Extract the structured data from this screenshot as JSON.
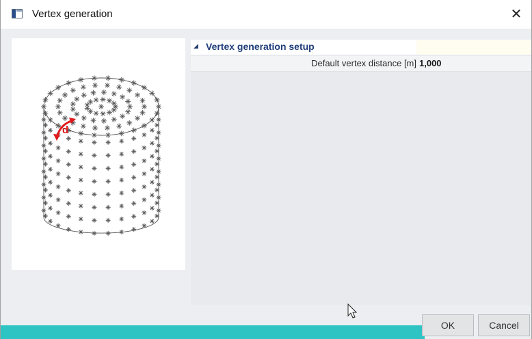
{
  "window": {
    "title": "Vertex generation",
    "close_glyph": "✕"
  },
  "property_group": {
    "label": "Vertex generation setup",
    "expander_glyph": "◢"
  },
  "property": {
    "label": "Default vertex distance [m]",
    "value": "1,000"
  },
  "preview": {
    "dimension_label": "d"
  },
  "buttons": {
    "ok": "OK",
    "cancel": "Cancel"
  },
  "colors": {
    "accent": "#2ec4c4",
    "group_text": "#1f3d7a",
    "dimension": "#e0191b"
  }
}
